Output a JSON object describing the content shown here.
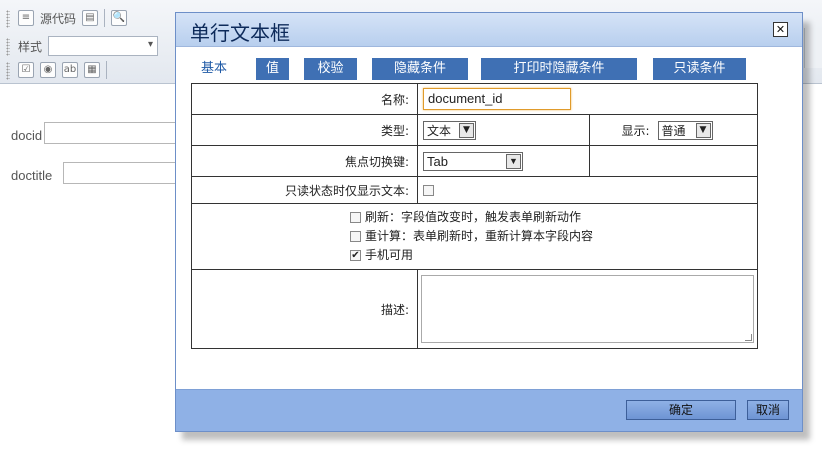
{
  "background": {
    "toolbar": {
      "source_code_label": "源代码",
      "style_label": "样式"
    },
    "fields": [
      {
        "label": "docid"
      },
      {
        "label": "doctitle"
      }
    ]
  },
  "dialog": {
    "title": "单行文本框",
    "close_symbol": "✕",
    "tabs": [
      {
        "label": "基本",
        "active": true
      },
      {
        "label": "值"
      },
      {
        "label": "校验"
      },
      {
        "label": "隐藏条件"
      },
      {
        "label": "打印时隐藏条件"
      },
      {
        "label": "只读条件"
      }
    ],
    "form": {
      "name_label": "名称:",
      "name_value": "document_id",
      "type_label": "类型:",
      "type_value": "文本",
      "display_label": "显示:",
      "display_value": "普通",
      "focus_label": "焦点切换键:",
      "focus_value": "Tab",
      "readonly_label": "只读状态时仅显示文本:",
      "options": [
        {
          "label": "刷新：字段值改变时，触发表单刷新动作",
          "checked": false
        },
        {
          "label": "重计算：表单刷新时，重新计算本字段内容",
          "checked": false
        },
        {
          "label": "手机可用",
          "checked": true
        }
      ],
      "description_label": "描述:"
    },
    "footer": {
      "ok_label": "确定",
      "cancel_label": "取消"
    },
    "colors": {
      "tab_bg": "#3f70b4",
      "footer_bg": "#8fb1e6",
      "header_bg": "#c5d9f3"
    }
  }
}
